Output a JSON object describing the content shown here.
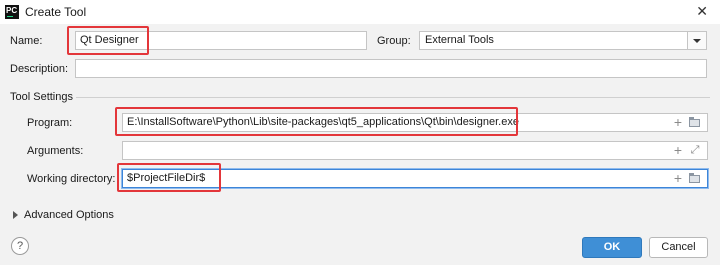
{
  "window": {
    "title": "Create Tool",
    "app_icon_text": "PC",
    "close_symbol": "✕"
  },
  "form": {
    "name_label": "Name:",
    "name_value": "Qt Designer",
    "group_label": "Group:",
    "group_value": "External Tools",
    "description_label": "Description:",
    "description_value": ""
  },
  "tool_settings": {
    "heading": "Tool Settings",
    "program_label": "Program:",
    "program_value": "E:\\InstallSoftware\\Python\\Lib\\site-packages\\qt5_applications\\Qt\\bin\\designer.exe",
    "arguments_label": "Arguments:",
    "arguments_value": "",
    "working_dir_label": "Working directory:",
    "working_dir_value": "$ProjectFileDir$"
  },
  "advanced": {
    "label": "Advanced Options"
  },
  "footer": {
    "help_symbol": "?",
    "ok_label": "OK",
    "cancel_label": "Cancel"
  },
  "icons": {
    "add": "+",
    "expand": "⤢"
  },
  "colors": {
    "highlight": "#e3363a",
    "ok_button": "#3f8fd6",
    "focus_border": "#3d85d8"
  }
}
